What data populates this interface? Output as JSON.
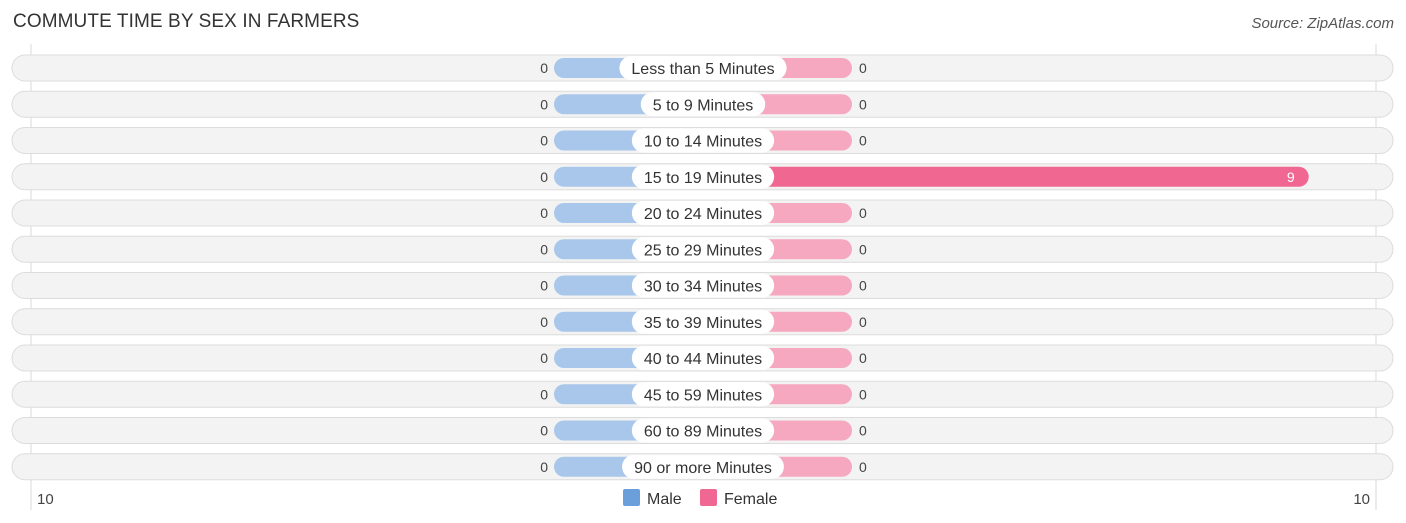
{
  "chart_data": {
    "type": "bar",
    "orientation": "horizontal-diverging",
    "title": "COMMUTE TIME BY SEX IN FARMERS",
    "source": "Source: ZipAtlas.com",
    "categories": [
      "Less than 5 Minutes",
      "5 to 9 Minutes",
      "10 to 14 Minutes",
      "15 to 19 Minutes",
      "20 to 24 Minutes",
      "25 to 29 Minutes",
      "30 to 34 Minutes",
      "35 to 39 Minutes",
      "40 to 44 Minutes",
      "45 to 59 Minutes",
      "60 to 89 Minutes",
      "90 or more Minutes"
    ],
    "series": [
      {
        "name": "Male",
        "color": "#6a9fdb",
        "light_color": "#a9c7ea",
        "values": [
          0,
          0,
          0,
          0,
          0,
          0,
          0,
          0,
          0,
          0,
          0,
          0
        ]
      },
      {
        "name": "Female",
        "color": "#f06792",
        "light_color": "#f5a8c0",
        "values": [
          0,
          0,
          0,
          9,
          0,
          0,
          0,
          0,
          0,
          0,
          0,
          0
        ]
      }
    ],
    "axis": {
      "min_label": "10",
      "max_label": "10",
      "range": [
        -10,
        10
      ]
    },
    "legend": {
      "position": "bottom-center",
      "items": [
        "Male",
        "Female"
      ]
    }
  }
}
